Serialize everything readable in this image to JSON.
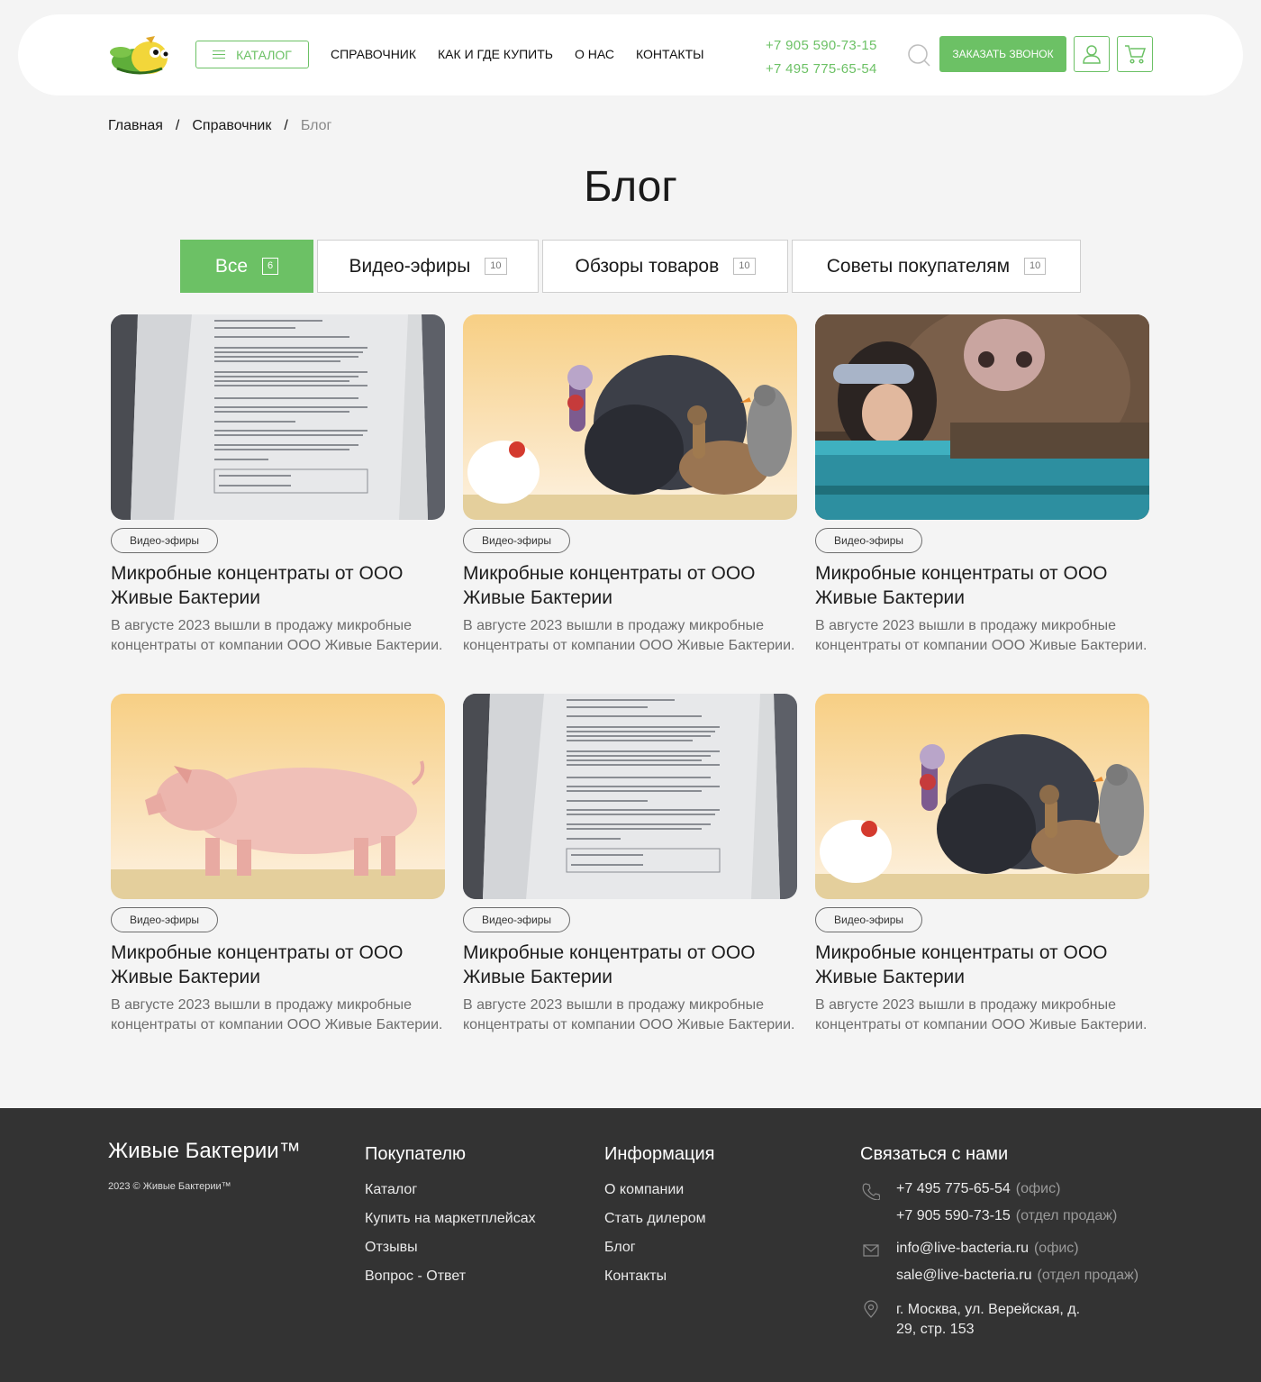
{
  "header": {
    "catalog_label": "КАТАЛОГ",
    "nav": [
      "СПРАВОЧНИК",
      "КАК И ГДЕ КУПИТЬ",
      "О НАС",
      "КОНТАКТЫ"
    ],
    "phone1": "+7 905 590-73-15",
    "phone2": "+7 495 775-65-54",
    "call_label": "ЗАКАЗАТЬ ЗВОНОК"
  },
  "breadcrumb": [
    "Главная",
    "Справочник",
    "Блог"
  ],
  "page_title": "Блог",
  "tabs": [
    {
      "label": "Все",
      "count": "6",
      "active": true
    },
    {
      "label": "Видео-эфиры",
      "count": "10"
    },
    {
      "label": "Обзоры товаров",
      "count": "10"
    },
    {
      "label": "Советы покупателям",
      "count": "10"
    }
  ],
  "cards": [
    {
      "image": "product-package",
      "tag": "Видео-эфиры",
      "title": "Микробные концентраты от ООО Живые Бактерии",
      "desc": "В августе 2023 вышли в продажу микробные концентраты от компании ООО Живые Бактерии."
    },
    {
      "image": "poultry",
      "tag": "Видео-эфиры",
      "title": "Микробные концентраты от ООО Живые Бактерии",
      "desc": "В августе 2023 вышли в продажу микробные концентраты от компании ООО Живые Бактерии."
    },
    {
      "image": "woman-and-cow",
      "tag": "Видео-эфиры",
      "title": "Микробные концентраты от ООО Живые Бактерии",
      "desc": "В августе 2023 вышли в продажу микробные концентраты от компании ООО Живые Бактерии."
    },
    {
      "image": "pig",
      "tag": "Видео-эфиры",
      "title": "Микробные концентраты от ООО Живые Бактерии",
      "desc": "В августе 2023 вышли в продажу микробные концентраты от компании ООО Живые Бактерии."
    },
    {
      "image": "product-package",
      "tag": "Видео-эфиры",
      "title": "Микробные концентраты от ООО Живые Бактерии",
      "desc": "В августе 2023 вышли в продажу микробные концентраты от компании ООО Живые Бактерии."
    },
    {
      "image": "poultry",
      "tag": "Видео-эфиры",
      "title": "Микробные концентраты от ООО Живые Бактерии",
      "desc": "В августе 2023 вышли в продажу микробные концентраты от компании ООО Живые Бактерии."
    }
  ],
  "footer": {
    "brand": "Живые Бактерии™",
    "copyright": "2023 © Живые Бактерии™",
    "buyer": {
      "title": "Покупателю",
      "links": [
        "Каталог",
        "Купить на маркетплейсах",
        "Отзывы",
        "Вопрос - Ответ"
      ]
    },
    "info": {
      "title": "Информация",
      "links": [
        "О компании",
        "Стать дилером",
        "Блог",
        "Контакты"
      ]
    },
    "contact": {
      "title": "Связаться с нами",
      "phone1": "+7 495 775-65-54",
      "phone1_note": "(офис)",
      "phone2": "+7 905 590-73-15",
      "phone2_note": "(отдел продаж)",
      "email1": "info@live-bacteria.ru",
      "email1_note": "(офис)",
      "email2": "sale@live-bacteria.ru",
      "email2_note": "(отдел продаж)",
      "address_line1": "г. Москва, ул. Верейская, д.",
      "address_line2": "29, стр. 153"
    }
  },
  "colors": {
    "accent": "#6cc165",
    "footer_bg": "#333333",
    "page_bg": "#f4f4f4"
  }
}
